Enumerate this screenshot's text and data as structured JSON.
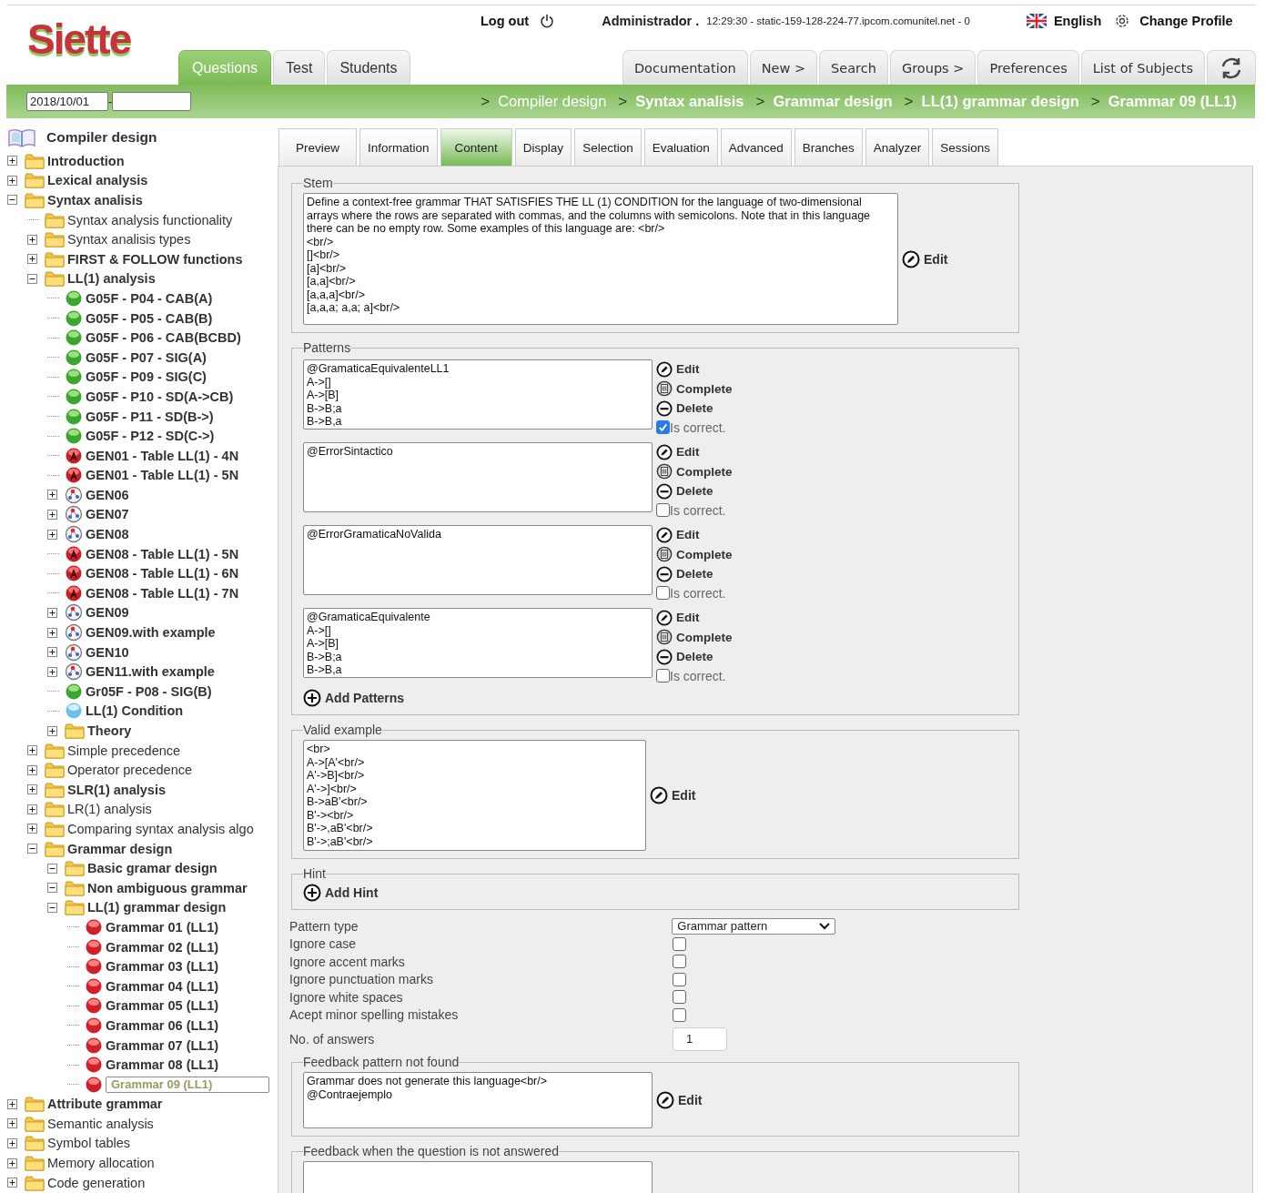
{
  "header": {
    "logo": "Siette",
    "logout": "Log out",
    "user": "Administrador .",
    "session": "12:29:30 - static-159-128-224-77.ipcom.comunitel.net - 0",
    "language": "English",
    "change_profile": "Change Profile"
  },
  "main_tabs": [
    {
      "label": "Questions",
      "selected": true
    },
    {
      "label": "Test",
      "selected": false
    },
    {
      "label": "Students",
      "selected": false
    }
  ],
  "menu": [
    "Documentation",
    "New >",
    "Search",
    "Groups >",
    "Preferences",
    "List of Subjects"
  ],
  "date_range": {
    "from": "2018/10/01",
    "separator": "-"
  },
  "breadcrumb": {
    "separator": ">",
    "items": [
      {
        "label": "Compiler design",
        "bold": false
      },
      {
        "label": "Syntax analisis",
        "bold": true
      },
      {
        "label": "Grammar design",
        "bold": true
      },
      {
        "label": "LL(1) grammar design",
        "bold": true
      },
      {
        "label": "Grammar 09 (LL1)",
        "bold": true
      }
    ]
  },
  "sidebar": {
    "root": "Compiler design",
    "items": [
      {
        "label": "Introduction",
        "kind": "folder",
        "bold": true,
        "selected": false,
        "expanded": false
      },
      {
        "label": "Lexical analysis",
        "kind": "folder",
        "bold": true,
        "selected": false,
        "expanded": false
      },
      {
        "label": "Syntax analisis",
        "kind": "folder",
        "bold": true,
        "selected": false,
        "expanded": true,
        "children": [
          {
            "label": "Syntax analysis functionality",
            "kind": "folder",
            "bold": false,
            "selected": false
          },
          {
            "label": "Syntax analisis types",
            "kind": "folder",
            "bold": false,
            "selected": false,
            "expanded": false
          },
          {
            "label": "FIRST & FOLLOW functions",
            "kind": "folder",
            "bold": true,
            "selected": false,
            "expanded": false
          },
          {
            "label": "LL(1) analysis",
            "kind": "folder",
            "bold": true,
            "selected": false,
            "expanded": true,
            "children": [
              {
                "label": "G05F - P04 - CAB(A)",
                "kind": "green",
                "bold": true,
                "selected": false
              },
              {
                "label": "G05F - P05 - CAB(B)",
                "kind": "green",
                "bold": true,
                "selected": false
              },
              {
                "label": "G05F - P06 - CAB(BCBD)",
                "kind": "green",
                "bold": true,
                "selected": false
              },
              {
                "label": "G05F - P07 - SIG(A)",
                "kind": "green",
                "bold": true,
                "selected": false
              },
              {
                "label": "G05F - P09 - SIG(C)",
                "kind": "green",
                "bold": true,
                "selected": false
              },
              {
                "label": "G05F - P10 - SD(A->CB)",
                "kind": "green",
                "bold": true,
                "selected": false
              },
              {
                "label": "G05F - P11 - SD(B->)",
                "kind": "green",
                "bold": true,
                "selected": false
              },
              {
                "label": "G05F - P12 - SD(C->)",
                "kind": "green",
                "bold": true,
                "selected": false
              },
              {
                "label": "GEN01 - Table LL(1) - 4N",
                "kind": "marked",
                "bold": true,
                "selected": false
              },
              {
                "label": "GEN01 - Table LL(1) - 5N",
                "kind": "marked",
                "bold": true,
                "selected": false
              },
              {
                "label": "GEN06",
                "kind": "network",
                "bold": true,
                "selected": false,
                "expanded": false
              },
              {
                "label": "GEN07",
                "kind": "network",
                "bold": true,
                "selected": false,
                "expanded": false
              },
              {
                "label": "GEN08",
                "kind": "network",
                "bold": true,
                "selected": false,
                "expanded": false
              },
              {
                "label": "GEN08 - Table LL(1) - 5N",
                "kind": "marked",
                "bold": true,
                "selected": false
              },
              {
                "label": "GEN08 - Table LL(1) - 6N",
                "kind": "marked",
                "bold": true,
                "selected": false
              },
              {
                "label": "GEN08 - Table LL(1) - 7N",
                "kind": "marked",
                "bold": true,
                "selected": false
              },
              {
                "label": "GEN09",
                "kind": "network",
                "bold": true,
                "selected": false,
                "expanded": false
              },
              {
                "label": "GEN09.with example",
                "kind": "network",
                "bold": true,
                "selected": false,
                "expanded": false
              },
              {
                "label": "GEN10",
                "kind": "network",
                "bold": true,
                "selected": false,
                "expanded": false
              },
              {
                "label": "GEN11.with example",
                "kind": "network",
                "bold": true,
                "selected": false,
                "expanded": false
              },
              {
                "label": "Gr05F - P08 - SIG(B)",
                "kind": "green",
                "bold": true,
                "selected": false
              },
              {
                "label": "LL(1) Condition",
                "kind": "blue",
                "bold": true,
                "selected": false
              },
              {
                "label": "Theory",
                "kind": "folder",
                "bold": true,
                "selected": false,
                "expanded": false
              }
            ]
          },
          {
            "label": "Simple precedence",
            "kind": "folder",
            "bold": false,
            "selected": false,
            "expanded": false
          },
          {
            "label": "Operator precedence",
            "kind": "folder",
            "bold": false,
            "selected": false,
            "expanded": false
          },
          {
            "label": "SLR(1) analysis",
            "kind": "folder",
            "bold": true,
            "selected": false,
            "expanded": false
          },
          {
            "label": "LR(1) analysis",
            "kind": "folder",
            "bold": false,
            "selected": false,
            "expanded": false
          },
          {
            "label": "Comparing syntax analysis algo",
            "kind": "folder",
            "bold": false,
            "selected": false,
            "expanded": false
          },
          {
            "label": "Grammar design",
            "kind": "folder",
            "bold": true,
            "selected": false,
            "expanded": true,
            "children": [
              {
                "label": "Basic gramar design",
                "kind": "folder",
                "bold": true,
                "selected": false,
                "expanded": true
              },
              {
                "label": "Non ambiguous grammar",
                "kind": "folder",
                "bold": true,
                "selected": false,
                "expanded": true
              },
              {
                "label": "LL(1) grammar design",
                "kind": "folder",
                "bold": true,
                "selected": false,
                "expanded": true,
                "children": [
                  {
                    "label": "Grammar 01 (LL1)",
                    "kind": "red",
                    "bold": true,
                    "selected": false
                  },
                  {
                    "label": "Grammar 02 (LL1)",
                    "kind": "red",
                    "bold": true,
                    "selected": false
                  },
                  {
                    "label": "Grammar 03 (LL1)",
                    "kind": "red",
                    "bold": true,
                    "selected": false
                  },
                  {
                    "label": "Grammar 04 (LL1)",
                    "kind": "red",
                    "bold": true,
                    "selected": false
                  },
                  {
                    "label": "Grammar 05 (LL1)",
                    "kind": "red",
                    "bold": true,
                    "selected": false
                  },
                  {
                    "label": "Grammar 06 (LL1)",
                    "kind": "red",
                    "bold": true,
                    "selected": false
                  },
                  {
                    "label": "Grammar 07 (LL1)",
                    "kind": "red",
                    "bold": true,
                    "selected": false
                  },
                  {
                    "label": "Grammar 08 (LL1)",
                    "kind": "red",
                    "bold": true,
                    "selected": false
                  },
                  {
                    "label": "Grammar 09 (LL1)",
                    "kind": "red",
                    "bold": true,
                    "selected": true
                  }
                ]
              }
            ]
          }
        ]
      },
      {
        "label": "Attribute grammar",
        "kind": "folder",
        "bold": true,
        "selected": false,
        "expanded": false
      },
      {
        "label": "Semantic analysis",
        "kind": "folder",
        "bold": false,
        "selected": false,
        "expanded": false
      },
      {
        "label": "Symbol tables",
        "kind": "folder",
        "bold": false,
        "selected": false,
        "expanded": false
      },
      {
        "label": "Memory allocation",
        "kind": "folder",
        "bold": false,
        "selected": false,
        "expanded": false
      },
      {
        "label": "Code generation",
        "kind": "folder",
        "bold": false,
        "selected": false,
        "expanded": false
      }
    ]
  },
  "content_tabs": [
    {
      "label": "Preview",
      "selected": false
    },
    {
      "label": "Information",
      "selected": false
    },
    {
      "label": "Content",
      "selected": true
    },
    {
      "label": "Display",
      "selected": false
    },
    {
      "label": "Selection",
      "selected": false
    },
    {
      "label": "Evaluation",
      "selected": false
    },
    {
      "label": "Advanced",
      "selected": false
    },
    {
      "label": "Branches",
      "selected": false
    },
    {
      "label": "Analyzer",
      "selected": false
    },
    {
      "label": "Sessions",
      "selected": false
    }
  ],
  "stem": {
    "legend": "Stem",
    "text": "Define a context-free grammar THAT SATISFIES THE LL (1) CONDITION for the language of two-dimensional arrays where the rows are separated with commas, and the columns with semicolons. Note that in this language there can be no empty row. Some examples of this language are: <br/>\n<br/>\n[]<br/>\n[a]<br/>\n[a,a]<br/>\n[a,a,a]<br/>\n[a,a,a; a,a; a]<br/>",
    "edit": "Edit"
  },
  "patterns": {
    "legend": "Patterns",
    "items": [
      {
        "text": "@GramaticaEquivalenteLL1\nA->[]\nA->[B]\nB->B;a\nB->B,a",
        "actions": [
          "Edit",
          "Complete",
          "Delete"
        ],
        "correct_label": "Is correct.",
        "correct": true
      },
      {
        "text": "@ErrorSintactico",
        "actions": [
          "Edit",
          "Complete",
          "Delete"
        ],
        "correct_label": "Is correct.",
        "correct": false
      },
      {
        "text": "@ErrorGramaticaNoValida",
        "actions": [
          "Edit",
          "Complete",
          "Delete"
        ],
        "correct_label": "Is correct.",
        "correct": false
      },
      {
        "text": "@GramaticaEquivalente\nA->[]\nA->[B]\nB->B;a\nB->B,a",
        "actions": [
          "Edit",
          "Complete",
          "Delete"
        ],
        "correct_label": "Is correct.",
        "correct": false
      }
    ],
    "add": "Add Patterns"
  },
  "valid_example": {
    "legend": "Valid example",
    "text": "<br>\nA->[A'<br/>\nA'->B]<br/>\nA'->]<br/>\nB->aB'<br/>\nB'-><br/>\nB'->,aB'<br/>\nB'->;aB'<br/>",
    "edit": "Edit"
  },
  "hint": {
    "legend": "Hint",
    "add": "Add Hint"
  },
  "options": {
    "pattern_type": {
      "label": "Pattern type",
      "value": "Grammar pattern"
    },
    "checks": [
      {
        "label": "Ignore case",
        "checked": false
      },
      {
        "label": "Ignore accent marks",
        "checked": false
      },
      {
        "label": "Ignore punctuation marks",
        "checked": false
      },
      {
        "label": "Ignore white spaces",
        "checked": false
      },
      {
        "label": "Acept minor spelling mistakes",
        "checked": false
      }
    ],
    "answers": {
      "label": "No. of answers",
      "value": "1"
    }
  },
  "feedback_not_found": {
    "legend": "Feedback pattern not found",
    "text": "Grammar does not generate this language<br/>\n@Contraejemplo",
    "edit": "Edit"
  },
  "feedback_not_answered": {
    "legend": "Feedback when the question is not answered"
  }
}
